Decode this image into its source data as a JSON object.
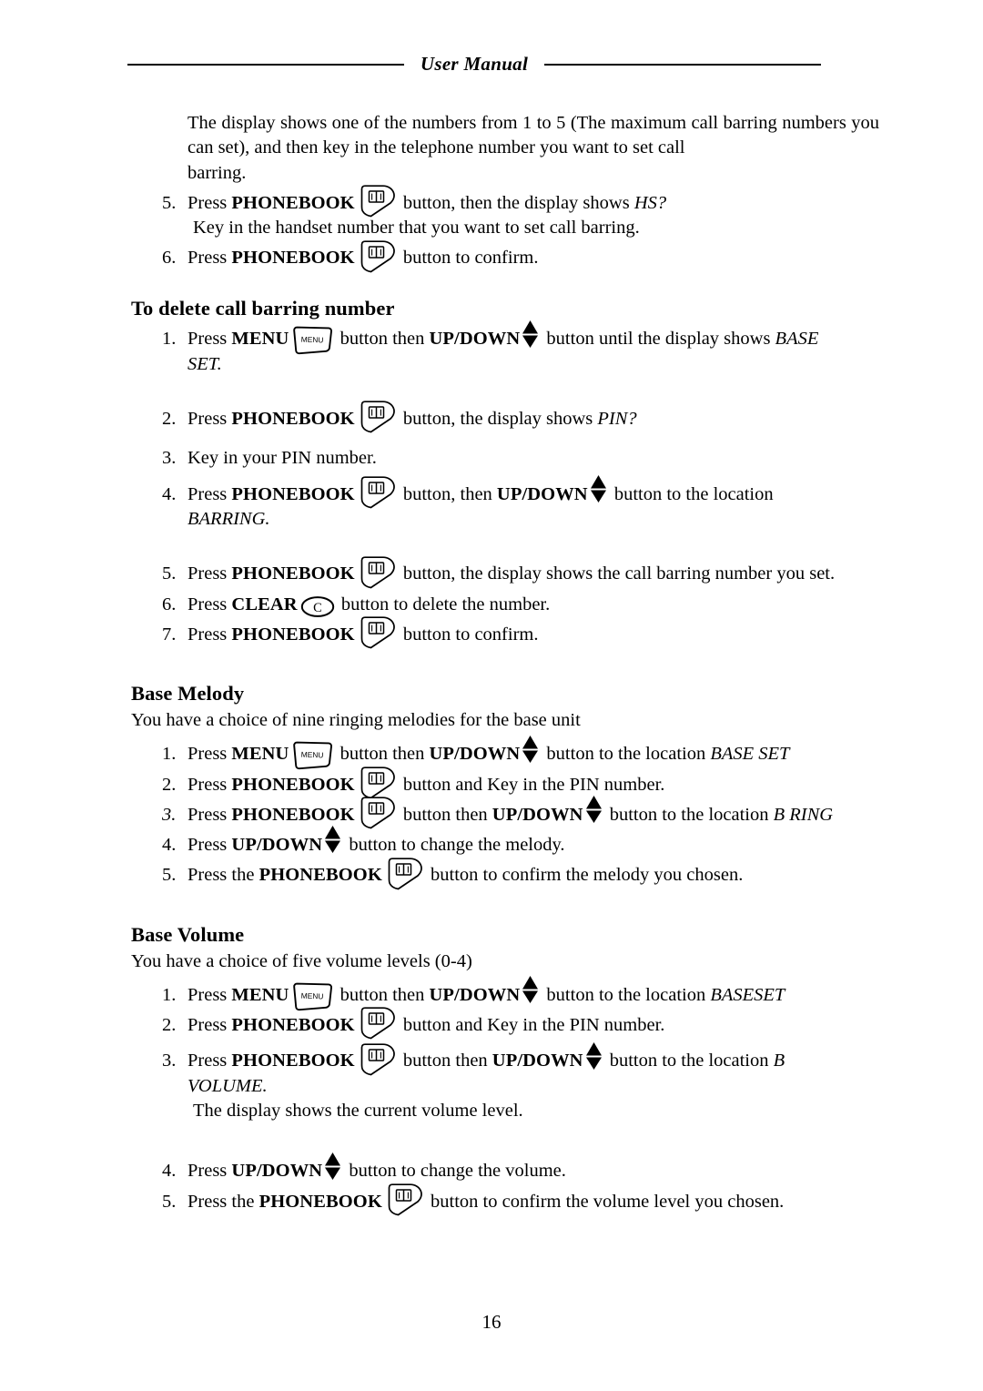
{
  "header": {
    "title": "User Manual"
  },
  "icons": {
    "phonebook": "phonebook-icon",
    "menu": "menu-icon",
    "menu_label": "MENU",
    "updown": "up-down-arrows-icon",
    "clear": "clear-icon",
    "clear_label": "C"
  },
  "intro": {
    "text": "The display shows one of the numbers from 1 to 5 (The maximum call barring numbers you can set), and then key in the telephone number you want to set call",
    "last_line": "barring."
  },
  "continued_steps": [
    {
      "num": "5.",
      "parts": [
        "Press ",
        "PHONEBOOK",
        " button, then the display shows ",
        "HS?"
      ],
      "sub": "Key in the handset number that you want to set call barring."
    },
    {
      "num": "6.",
      "parts": [
        "Press ",
        "PHONEBOOK",
        " button to confirm."
      ]
    }
  ],
  "sections": [
    {
      "heading": "To delete call barring number",
      "intro": "",
      "steps": [
        {
          "num": "1.",
          "pre": "Press ",
          "kw1": "MENU",
          "mid": " button then ",
          "kw2": "UP/DOWN",
          "post": " button until the display shows ",
          "target": "BASE",
          "cont": "SET."
        },
        {
          "num": "2.",
          "pre": "Press ",
          "kw1": "PHONEBOOK",
          "post": " button, the display shows ",
          "target": "PIN?"
        },
        {
          "num": "3.",
          "plain": "Key in your PIN number."
        },
        {
          "num": "4.",
          "pre": "Press ",
          "kw1": "PHONEBOOK",
          "mid": " button, then ",
          "kw2": "UP/DOWN",
          "post": " button to the location",
          "cont": "BARRING."
        },
        {
          "num": "5.",
          "pre": "Press ",
          "kw1": "PHONEBOOK",
          "post": " button, the display shows the call barring number you set."
        },
        {
          "num": "6.",
          "pre": "Press ",
          "kw1": "CLEAR",
          "post": " button to delete the number."
        },
        {
          "num": "7.",
          "pre": "Press ",
          "kw1": "PHONEBOOK",
          "post": " button to confirm."
        }
      ]
    },
    {
      "heading": "Base Melody",
      "intro": "You have a choice of nine ringing melodies for the base unit",
      "steps": [
        {
          "num": "1.",
          "pre": "Press ",
          "kw1": "MENU",
          "mid": " button then ",
          "kw2": "UP/DOWN",
          "post": " button to the location ",
          "target": "BASE SET"
        },
        {
          "num": "2.",
          "pre": "Press ",
          "kw1": "PHONEBOOK",
          "post": " button and Key in the PIN number."
        },
        {
          "num": "3.",
          "num_italic": true,
          "pre": "Press ",
          "kw1": "PHONEBOOK",
          "mid": " button then ",
          "kw2": "UP/DOWN",
          "post": " button to the location ",
          "target": "B RING"
        },
        {
          "num": "4.",
          "pre": "Press ",
          "kw2": "UP/DOWN",
          "post": " button to change the melody."
        },
        {
          "num": "5.",
          "pre": "Press the ",
          "kw1": "PHONEBOOK",
          "post": " button to confirm the melody you chosen."
        }
      ]
    },
    {
      "heading": "Base Volume",
      "intro": "You have a choice of five volume levels (0-4)",
      "steps": [
        {
          "num": "1.",
          "pre": "Press ",
          "kw1": "MENU",
          "mid": " button then ",
          "kw2": "UP/DOWN",
          "post": " button to the location ",
          "target": "BASESET"
        },
        {
          "num": "2.",
          "pre": "Press ",
          "kw1": "PHONEBOOK",
          "post": " button and Key in the PIN number."
        },
        {
          "num": "3.",
          "pre": "Press ",
          "kw1": "PHONEBOOK",
          "mid": " button then ",
          "kw2": "UP/DOWN",
          "post": " button to the location ",
          "target": "B",
          "cont": "VOLUME.",
          "sub": "The display shows the current volume level."
        },
        {
          "num": "4.",
          "pre": "Press ",
          "kw2": "UP/DOWN",
          "post": " button to change the volume."
        },
        {
          "num": "5.",
          "pre": "Press the ",
          "kw1": "PHONEBOOK",
          "post": " button to confirm the volume level you chosen."
        }
      ]
    }
  ],
  "footer": {
    "page_number": "16"
  }
}
